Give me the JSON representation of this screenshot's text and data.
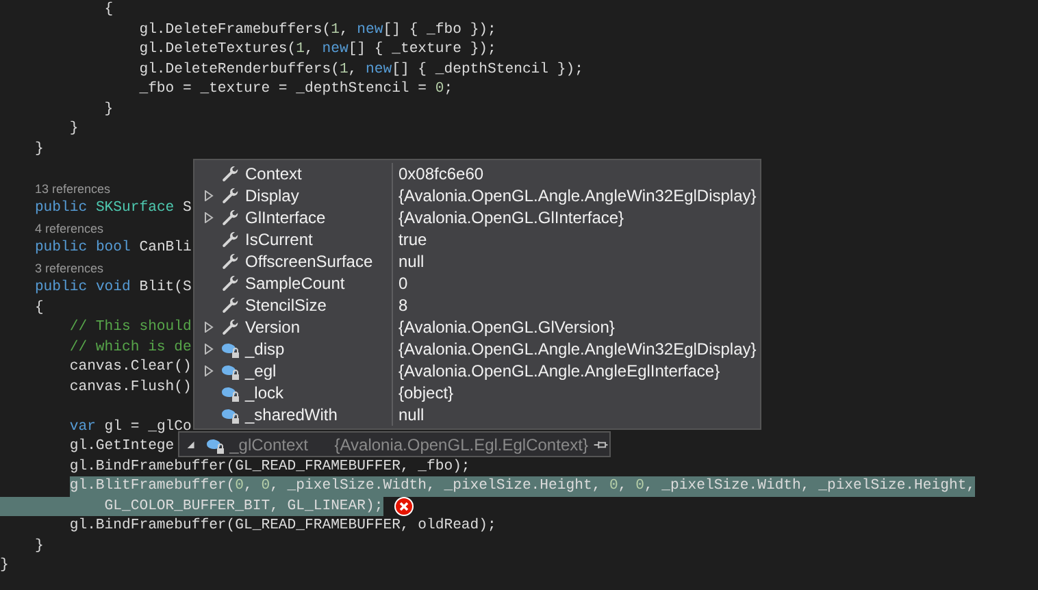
{
  "code_lines": [
    {
      "kind": "code",
      "text_parts": [
        {
          "kind": "plain",
          "text": "            {"
        }
      ]
    },
    {
      "kind": "code",
      "text_parts": [
        {
          "kind": "plain",
          "text": "                gl.DeleteFramebuffers("
        },
        {
          "kind": "number",
          "text": "1"
        },
        {
          "kind": "plain",
          "text": ", "
        },
        {
          "kind": "keyword",
          "text": "new"
        },
        {
          "kind": "plain",
          "text": "[] { _fbo });"
        }
      ]
    },
    {
      "kind": "code",
      "text_parts": [
        {
          "kind": "plain",
          "text": "                gl.DeleteTextures("
        },
        {
          "kind": "number",
          "text": "1"
        },
        {
          "kind": "plain",
          "text": ", "
        },
        {
          "kind": "keyword",
          "text": "new"
        },
        {
          "kind": "plain",
          "text": "[] { _texture });"
        }
      ]
    },
    {
      "kind": "code",
      "text_parts": [
        {
          "kind": "plain",
          "text": "                gl.DeleteRenderbuffers("
        },
        {
          "kind": "number",
          "text": "1"
        },
        {
          "kind": "plain",
          "text": ", "
        },
        {
          "kind": "keyword",
          "text": "new"
        },
        {
          "kind": "plain",
          "text": "[] { _depthStencil });"
        }
      ]
    },
    {
      "kind": "code",
      "text_parts": [
        {
          "kind": "plain",
          "text": "                _fbo = _texture = _depthStencil = "
        },
        {
          "kind": "number",
          "text": "0"
        },
        {
          "kind": "plain",
          "text": ";"
        }
      ]
    },
    {
      "kind": "code",
      "text_parts": [
        {
          "kind": "plain",
          "text": "            }"
        }
      ]
    },
    {
      "kind": "code",
      "text_parts": [
        {
          "kind": "plain",
          "text": "        }"
        }
      ]
    },
    {
      "kind": "code",
      "text_parts": [
        {
          "kind": "plain",
          "text": "    }"
        }
      ]
    },
    {
      "kind": "blank"
    },
    {
      "kind": "references",
      "text": "13 references"
    },
    {
      "kind": "code",
      "text_parts": [
        {
          "kind": "keyword",
          "text": "    public "
        },
        {
          "kind": "type",
          "text": "SKSurface"
        },
        {
          "kind": "plain",
          "text": " S"
        }
      ]
    },
    {
      "kind": "references",
      "text": "4 references"
    },
    {
      "kind": "code",
      "text_parts": [
        {
          "kind": "keyword",
          "text": "    public bool"
        },
        {
          "kind": "plain",
          "text": " CanBli"
        }
      ]
    },
    {
      "kind": "references",
      "text": "3 references"
    },
    {
      "kind": "code",
      "text_parts": [
        {
          "kind": "keyword",
          "text": "    public void"
        },
        {
          "kind": "plain",
          "text": " Blit(S"
        }
      ]
    },
    {
      "kind": "code",
      "text_parts": [
        {
          "kind": "plain",
          "text": "    {"
        }
      ]
    },
    {
      "kind": "code",
      "text_parts": [
        {
          "kind": "comment",
          "text": "        // This should"
        }
      ]
    },
    {
      "kind": "code",
      "text_parts": [
        {
          "kind": "comment",
          "text": "        // which is de"
        }
      ]
    },
    {
      "kind": "code",
      "text_parts": [
        {
          "kind": "plain",
          "text": "        canvas.Clear()"
        }
      ]
    },
    {
      "kind": "code",
      "text_parts": [
        {
          "kind": "plain",
          "text": "        canvas.Flush()"
        }
      ]
    },
    {
      "kind": "blank"
    },
    {
      "kind": "code",
      "text_parts": [
        {
          "kind": "keyword",
          "text": "        var"
        },
        {
          "kind": "plain",
          "text": " gl = _glCo"
        }
      ]
    },
    {
      "kind": "code",
      "text_parts": [
        {
          "kind": "plain",
          "text": "        gl.GetIntege"
        }
      ]
    },
    {
      "kind": "code",
      "text_parts": [
        {
          "kind": "plain",
          "text": "        gl.BindFramebuffer(GL_READ_FRAMEBUFFER, _fbo);"
        }
      ]
    },
    {
      "kind": "code",
      "selected": true,
      "text_parts": [
        {
          "kind": "plain",
          "text": "        gl.BlitFramebuffer("
        },
        {
          "kind": "number",
          "text": "0"
        },
        {
          "kind": "plain",
          "text": ", "
        },
        {
          "kind": "number",
          "text": "0"
        },
        {
          "kind": "plain",
          "text": ", _pixelSize.Width, _pixelSize.Height, "
        },
        {
          "kind": "number",
          "text": "0"
        },
        {
          "kind": "plain",
          "text": ", "
        },
        {
          "kind": "number",
          "text": "0"
        },
        {
          "kind": "plain",
          "text": ", _pixelSize.Width, _pixelSize.Height,"
        }
      ]
    },
    {
      "kind": "code",
      "selected": true,
      "error": true,
      "text_parts": [
        {
          "kind": "plain",
          "text": "            GL_COLOR_BUFFER_BIT, GL_LINEAR);"
        }
      ]
    },
    {
      "kind": "code",
      "text_parts": [
        {
          "kind": "plain",
          "text": "        gl.BindFramebuffer(GL_READ_FRAMEBUFFER, oldRead);"
        }
      ]
    },
    {
      "kind": "code",
      "text_parts": [
        {
          "kind": "plain",
          "text": "    }"
        }
      ]
    },
    {
      "kind": "code",
      "text_parts": [
        {
          "kind": "plain",
          "text": "}"
        }
      ]
    }
  ],
  "datatip": {
    "name": "_glContext",
    "value": "{Avalonia.OpenGL.Egl.EglContext}",
    "expanded": true,
    "members": [
      {
        "kind": "property",
        "expandable": false,
        "name": "Context",
        "value": "0x08fc6e60"
      },
      {
        "kind": "property",
        "expandable": true,
        "name": "Display",
        "value": "{Avalonia.OpenGL.Angle.AngleWin32EglDisplay}"
      },
      {
        "kind": "property",
        "expandable": true,
        "name": "GlInterface",
        "value": "{Avalonia.OpenGL.GlInterface}"
      },
      {
        "kind": "property",
        "expandable": false,
        "name": "IsCurrent",
        "value": "true"
      },
      {
        "kind": "property",
        "expandable": false,
        "name": "OffscreenSurface",
        "value": "null"
      },
      {
        "kind": "property",
        "expandable": false,
        "name": "SampleCount",
        "value": "0"
      },
      {
        "kind": "property",
        "expandable": false,
        "name": "StencilSize",
        "value": "8"
      },
      {
        "kind": "property",
        "expandable": true,
        "name": "Version",
        "value": "{Avalonia.OpenGL.GlVersion}"
      },
      {
        "kind": "field",
        "expandable": true,
        "name": "_disp",
        "value": "{Avalonia.OpenGL.Angle.AngleWin32EglDisplay}"
      },
      {
        "kind": "field",
        "expandable": true,
        "name": "_egl",
        "value": "{Avalonia.OpenGL.Angle.AngleEglInterface}"
      },
      {
        "kind": "field",
        "expandable": false,
        "name": "_lock",
        "value": "{object}"
      },
      {
        "kind": "field",
        "expandable": false,
        "name": "_sharedWith",
        "value": "null"
      }
    ]
  }
}
